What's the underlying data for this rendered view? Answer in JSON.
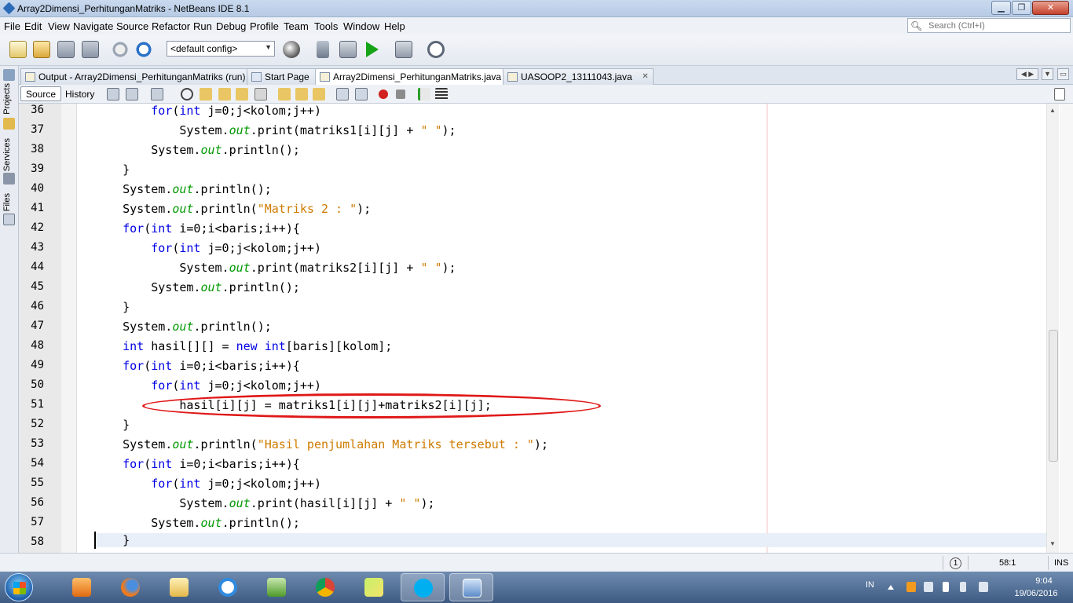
{
  "window": {
    "title": "Array2Dimensi_PerhitunganMatriks - NetBeans IDE 8.1",
    "min_label": "▁",
    "max_label": "❐",
    "close_label": "✕"
  },
  "menu": [
    "File",
    "Edit",
    "View",
    "Navigate",
    "Source",
    "Refactor",
    "Run",
    "Debug",
    "Profile",
    "Team",
    "Tools",
    "Window",
    "Help"
  ],
  "search": {
    "placeholder": "Search (Ctrl+I)"
  },
  "toolbar": {
    "config_value": "<default config>"
  },
  "sidebar": {
    "tabs": [
      "Projects",
      "Services",
      "Files"
    ]
  },
  "tabs": [
    {
      "label": "Output - Array2Dimensi_PerhitunganMatriks (run)",
      "active": false
    },
    {
      "label": "Start Page",
      "active": false
    },
    {
      "label": "Array2Dimensi_PerhitunganMatriks.java",
      "active": true
    },
    {
      "label": "UASOOP2_13111043.java",
      "active": false
    }
  ],
  "editor_toolbar": {
    "source_label": "Source",
    "history_label": "History"
  },
  "code": {
    "line_numbers": [
      "36",
      "37",
      "38",
      "39",
      "40",
      "41",
      "42",
      "43",
      "44",
      "45",
      "46",
      "47",
      "48",
      "49",
      "50",
      "51",
      "52",
      "53",
      "54",
      "55",
      "56",
      "57",
      "58"
    ],
    "lines": [
      "        for(int j=0;j<kolom;j++)",
      "            System.out.print(matriks1[i][j] + \" \");",
      "        System.out.println();",
      "    }",
      "    System.out.println();",
      "    System.out.println(\"Matriks 2 : \");",
      "    for(int i=0;i<baris;i++){",
      "        for(int j=0;j<kolom;j++)",
      "            System.out.print(matriks2[i][j] + \" \");",
      "        System.out.println();",
      "    }",
      "    System.out.println();",
      "    int hasil[][] = new int[baris][kolom];",
      "    for(int i=0;i<baris;i++){",
      "        for(int j=0;j<kolom;j++)",
      "            hasil[i][j] = matriks1[i][j]+matriks2[i][j];",
      "    }",
      "    System.out.println(\"Hasil penjumlahan Matriks tersebut : \");",
      "    for(int i=0;i<baris;i++){",
      "        for(int j=0;j<kolom;j++)",
      "            System.out.print(hasil[i][j] + \" \");",
      "        System.out.println();",
      "    }"
    ],
    "current_line": "58",
    "highlighted_line": "51",
    "highlight_color": "#e01818"
  },
  "status": {
    "position": "58:1",
    "mode": "INS",
    "notifications": "1"
  },
  "taskbar": {
    "apps": [
      "media-player-icon",
      "firefox-icon",
      "file-explorer-icon",
      "internet-explorer-icon",
      "netbeans-icon",
      "chrome-icon",
      "sticky-notes-icon",
      "skype-icon",
      "virtualbox-icon"
    ],
    "active_app": "skype-icon",
    "language": "IN",
    "time": "9:04",
    "date": "19/06/2016"
  }
}
